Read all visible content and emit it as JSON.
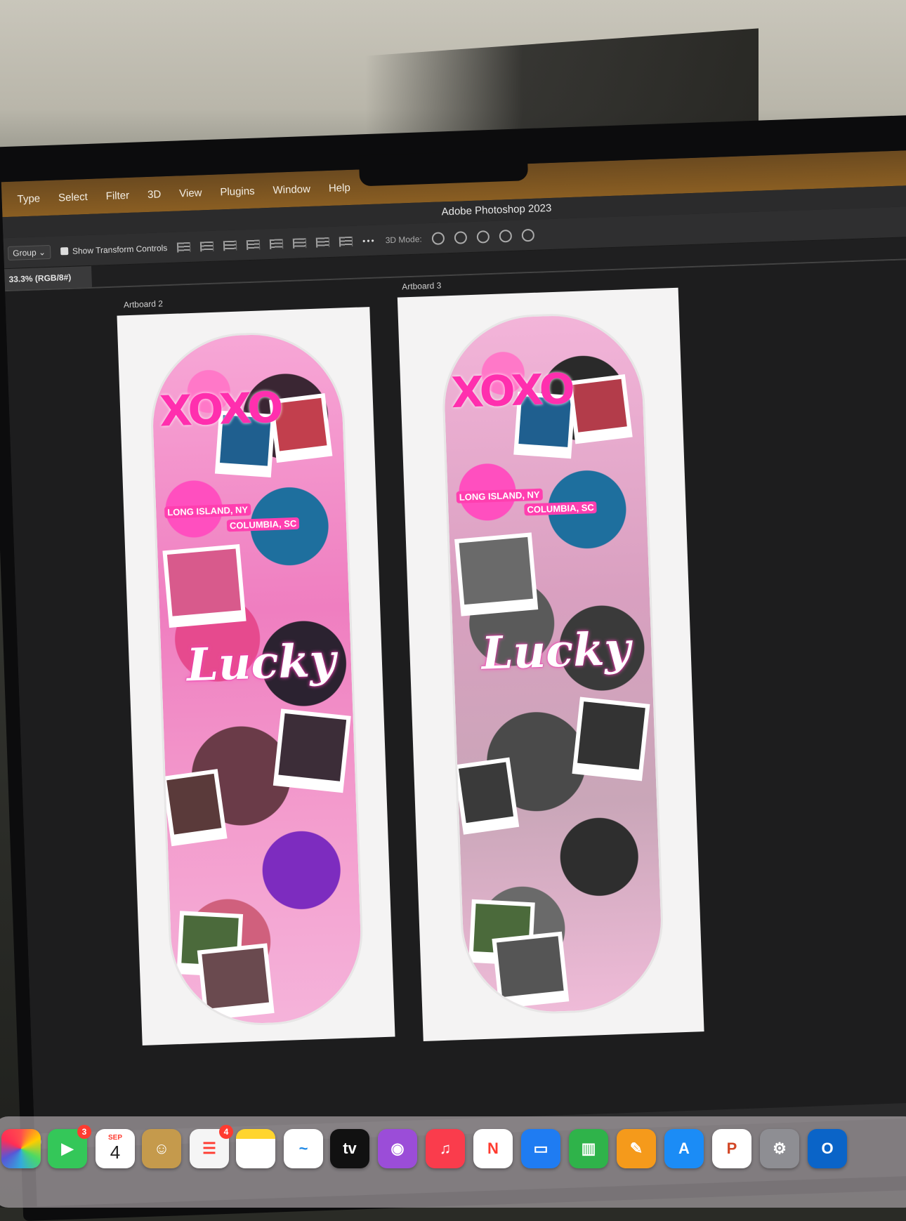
{
  "app": {
    "title": "Adobe Photoshop 2023",
    "menu": [
      "Type",
      "Select",
      "Filter",
      "3D",
      "View",
      "Plugins",
      "Window",
      "Help"
    ]
  },
  "options_bar": {
    "auto_select_value": "Group",
    "show_transform_label": "Show Transform Controls",
    "show_transform_checked": true,
    "more_label": "•••",
    "mode3d_label": "3D Mode:"
  },
  "document": {
    "tab_label": "33.3% (RGB/8#)",
    "status": ")"
  },
  "artboards": [
    {
      "label": "Artboard 2",
      "xoxo": "XOXO",
      "loc1": "LONG ISLAND, NY",
      "loc2": "COLUMBIA, SC",
      "script_text": "Lucky",
      "style": "color"
    },
    {
      "label": "Artboard 3",
      "xoxo": "XOXO",
      "loc1": "LONG ISLAND, NY",
      "loc2": "COLUMBIA, SC",
      "script_text": "Lucky",
      "style": "black-and-white"
    }
  ],
  "dock": [
    {
      "name": "photos-icon"
    },
    {
      "name": "facetime-icon",
      "badge": "3"
    },
    {
      "name": "calendar-icon",
      "month": "SEP",
      "day": "4"
    },
    {
      "name": "contacts-icon"
    },
    {
      "name": "reminders-icon",
      "badge": "4"
    },
    {
      "name": "notes-icon"
    },
    {
      "name": "freeform-icon"
    },
    {
      "name": "apple-tv-icon",
      "label": "tv"
    },
    {
      "name": "podcasts-icon"
    },
    {
      "name": "music-icon"
    },
    {
      "name": "news-icon"
    },
    {
      "name": "keynote-icon"
    },
    {
      "name": "numbers-icon"
    },
    {
      "name": "pages-icon"
    },
    {
      "name": "app-store-icon"
    },
    {
      "name": "powerpoint-icon",
      "label": "P"
    },
    {
      "name": "system-settings-icon"
    },
    {
      "name": "outlook-icon",
      "label": "O"
    }
  ]
}
